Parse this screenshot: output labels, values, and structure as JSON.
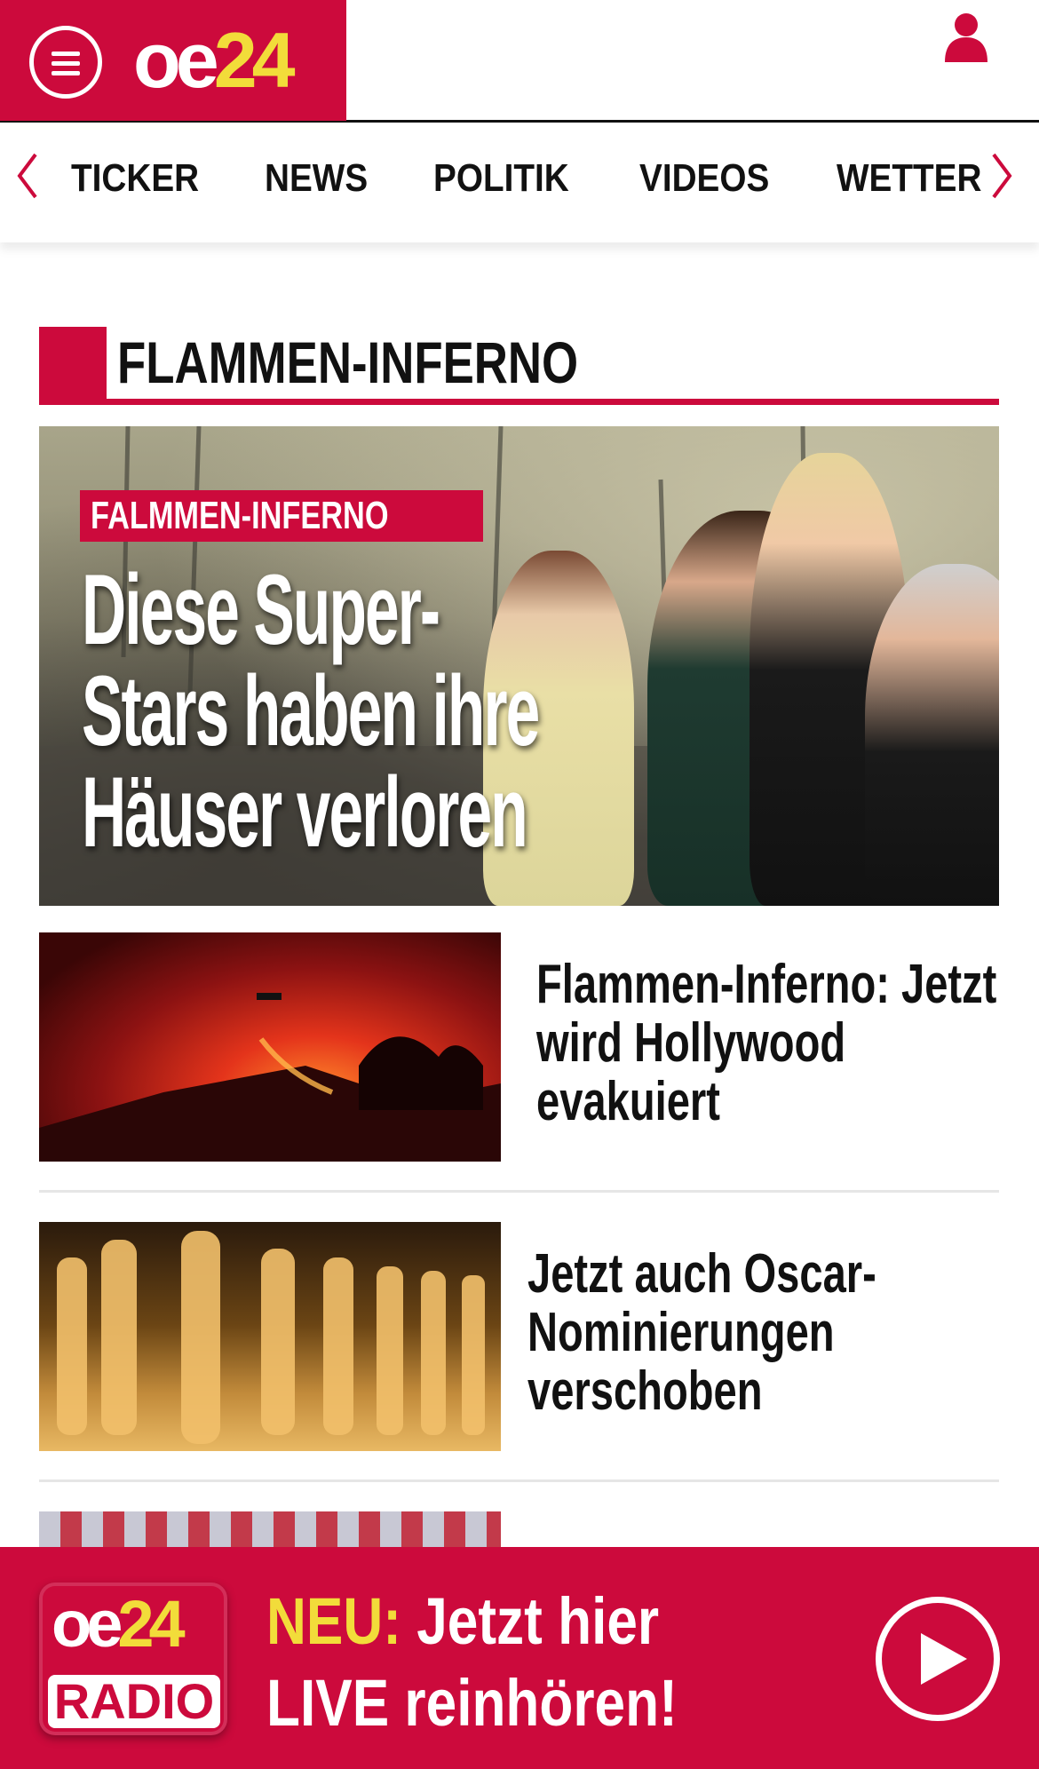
{
  "header": {
    "logo_oe": "oe",
    "logo_24": "24",
    "menu_icon": "hamburger-menu-icon",
    "user_icon": "user-icon",
    "brand_color": "#cc0a3c",
    "accent_color": "#f2dc3a"
  },
  "nav": {
    "items": [
      {
        "label": "TICKER"
      },
      {
        "label": "NEWS"
      },
      {
        "label": "POLITIK"
      },
      {
        "label": "VIDEOS"
      },
      {
        "label": "WETTER"
      }
    ],
    "prev_icon": "chevron-left-icon",
    "next_icon": "chevron-right-icon"
  },
  "section": {
    "title": "FLAMMEN-INFERNO"
  },
  "hero": {
    "kicker": "FALMMEN-INFERNO",
    "headline_lines": [
      "Diese Super-",
      "Stars haben ihre",
      "Häuser verloren"
    ]
  },
  "teasers": [
    {
      "title_lines": [
        "Flammen-Inferno: Jetzt",
        "wird Hollywood",
        "evakuiert"
      ]
    },
    {
      "title_lines": [
        "Jetzt auch Oscar-",
        "Nominierungen",
        "verschoben"
      ]
    }
  ],
  "radio": {
    "logo_oe": "oe",
    "logo_24": "24",
    "logo_label": "RADIO",
    "neu": "NEU:",
    "line1_rest": " Jetzt hier",
    "line2": "LIVE reinhören!",
    "play_icon": "play-icon"
  }
}
